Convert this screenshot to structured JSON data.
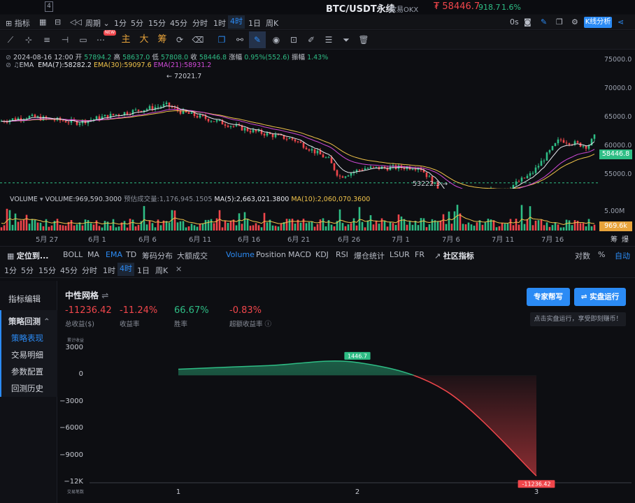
{
  "titlebar": {
    "tab_number": "4",
    "pair": "BTC/USDT永续",
    "exchange": "欧易OKX",
    "price": "₮ 58446.7",
    "change": "918.7",
    "change_pct": "1.6%"
  },
  "tfbar": {
    "indicators": "指标",
    "period": "周期",
    "items": [
      "1分",
      "5分",
      "15分",
      "45分",
      "分时",
      "1时",
      "4时",
      "1日",
      "周K"
    ],
    "active": "4时",
    "zero_s": "0s",
    "kline": "K线分析"
  },
  "toolbar": {
    "zhu": "主",
    "da": "大",
    "chou": "筹",
    "new_badge": "NEW"
  },
  "chart": {
    "date": "2024-08-16 12:00",
    "open_label": "开",
    "open": "57894.2",
    "high_label": "高",
    "high": "58637.0",
    "low_label": "低",
    "low": "57808.0",
    "close_label": "收",
    "close": "58446.8",
    "zf_label": "涨幅",
    "zf": "0.95%(552.6)",
    "zhenfu_label": "振幅",
    "zhenfu": "1.43%",
    "ema_name": "EMA",
    "ema7": "EMA(7):58282.2",
    "ema30": "EMA(30):59097.6",
    "ema21": "EMA(21):58931.2",
    "high_mark": "← 72021.7",
    "low_mark": "53222.3 →",
    "y_axis": [
      "75000.0",
      "70000.0",
      "65000.0",
      "60000.0",
      "55000.0"
    ],
    "last_price_tag": "58446.8",
    "dates": [
      "5月 27",
      "6月 1",
      "6月 6",
      "6月 11",
      "6月 16",
      "6月 21",
      "6月 26",
      "7月 1",
      "7月 6",
      "7月 11",
      "7月 16"
    ],
    "colors": {
      "up": "#2ebd85",
      "down": "#f0464b",
      "ema7": "#e6e8ee",
      "ema30": "#f0c34a",
      "ema21": "#d04ad8"
    }
  },
  "volume": {
    "label": "VOLUME",
    "value": "VOLUME:969,590.3000",
    "est": "预估成交量:1,176,945.1505",
    "ma5": "MA(5):2,663,021.3800",
    "ma10": "MA(10):2,060,070.3600",
    "axis_top": "5.00M",
    "tag": "969.6k",
    "right1": "筹",
    "right2": "爆"
  },
  "indbar": {
    "locate": "定位到...",
    "items": [
      "BOLL",
      "MA",
      "EMA",
      "TD",
      "筹码分布",
      "大额成交"
    ],
    "active": "EMA",
    "sub_items": [
      "Volume",
      "Position",
      "MACD",
      "KDJ",
      "RSI",
      "爆仓统计",
      "LSUR",
      "FR"
    ],
    "sub_active": "Volume",
    "community": "社区指标",
    "log": "对数",
    "pct": "%",
    "auto": "自动"
  },
  "tf2": {
    "items": [
      "1分",
      "5分",
      "15分",
      "45分",
      "分时",
      "1时",
      "4时",
      "1日",
      "周K"
    ],
    "active": "4时",
    "close": "✕"
  },
  "side": {
    "edit": "指标编辑",
    "backtest": "策略回测",
    "items": [
      "策略表现",
      "交易明细",
      "参数配置",
      "回测历史"
    ],
    "active": "策略表现"
  },
  "strategy": {
    "name": "中性网格",
    "stats": [
      {
        "value": "-11236.42",
        "label": "总收益($)",
        "color": "#f0464b"
      },
      {
        "value": "-11.24%",
        "label": "收益率",
        "color": "#f0464b"
      },
      {
        "value": "66.67%",
        "label": "胜率",
        "color": "#2ebd85"
      },
      {
        "value": "-0.83%",
        "label": "超额收益率",
        "color": "#f0464b"
      }
    ],
    "btn_expert": "专家帮写",
    "btn_live": "⇌ 实盘运行",
    "tip": "点击实盘运行，享受即刻赚币！",
    "y_title": "累计收益",
    "x_title": "交易笔数"
  },
  "chart_data": {
    "type": "line",
    "x": [
      1,
      1.5,
      2,
      2.5,
      3
    ],
    "series": [
      {
        "values": [
          700,
          1100,
          1446.7,
          -1800,
          -11236.42
        ]
      }
    ],
    "point_labels": [
      {
        "x": 2,
        "y": 1446.7,
        "text": "1446.7"
      },
      {
        "x": 3,
        "y": -11236.42,
        "text": "-11236.42"
      }
    ],
    "yticks": [
      "3000",
      "0",
      "−3000",
      "−6000",
      "−9000",
      "−12K"
    ],
    "xticks": [
      "1",
      "2",
      "3"
    ],
    "ylim": [
      -12000,
      3000
    ],
    "xlim": [
      1,
      3
    ],
    "ylabel": "累计收益",
    "xlabel": "交易笔数"
  }
}
